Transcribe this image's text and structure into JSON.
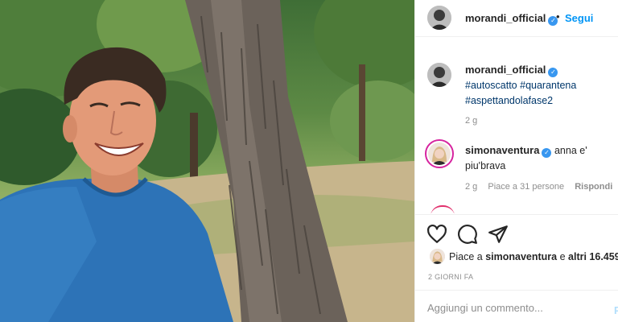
{
  "post": {
    "username": "morandi_official",
    "follow_label": "Segui",
    "separator": "•",
    "verified_mark": "✓"
  },
  "caption": {
    "username": "morandi_official",
    "hashtags": [
      "#autoscatto",
      "#quarantena",
      "#aspettandolafase2"
    ],
    "time": "2 g"
  },
  "comments": [
    {
      "username": "simonaventura",
      "text": "anna e' piu'brava",
      "time": "2 g",
      "likes": "Piace a 31 persone",
      "reply_label": "Rispondi"
    }
  ],
  "actions": {
    "icons": [
      "heart-icon",
      "comment-icon",
      "share-icon"
    ]
  },
  "likes": {
    "prefix": "Piace a",
    "user": "simonaventura",
    "middle": "e",
    "others": "altri 16.459"
  },
  "date": "2 GIORNI FA",
  "add_comment": {
    "placeholder": "Aggiungi un commento...",
    "publish_label": "P"
  },
  "colors": {
    "link_blue": "#0095f6",
    "hashtag_blue": "#00376b",
    "verified_blue": "#3897f0",
    "secondary_text": "#8e8e8e"
  }
}
